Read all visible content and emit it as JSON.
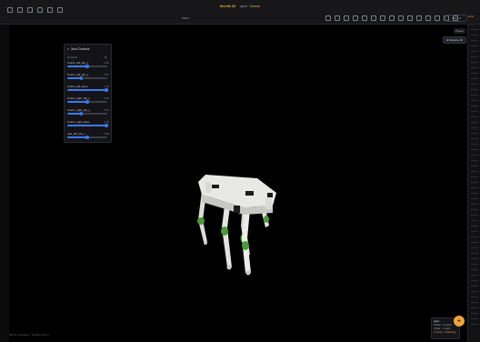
{
  "titlebar": {
    "app_title": "Kinetik 3D",
    "status_prefix": "quiet ·",
    "status_highlight": "branch",
    "file": "mass"
  },
  "toolbar": {
    "share_label": "Share ▾",
    "right_tab": "⊞ M"
  },
  "viewport": {
    "reset_label": "Preset",
    "reset_all_label": "⊕ Restore All",
    "footer_label": "Tap for overview · Scroll to zoom"
  },
  "joint_panel": {
    "title": "Joint Controls",
    "subtitle": "12 joints",
    "joints": [
      {
        "name": "FrontL_left_hip_x",
        "value": "0.00",
        "fraction": 0.5
      },
      {
        "name": "FrontL_left_hip_y",
        "value": "0.61",
        "fraction": 0.35
      },
      {
        "name": "FrontL_left_knee",
        "value": "0.00",
        "fraction": 0.98
      },
      {
        "name": "FrontL_right_hip_x",
        "value": "0.00",
        "fraction": 0.5
      },
      {
        "name": "FrontL_right_hip_y",
        "value": "0.61",
        "fraction": 0.35
      },
      {
        "name": "FrontL_right_knee",
        "value": "0.00",
        "fraction": 0.98
      },
      {
        "name": "rear_left_hip_x",
        "value": "0.00",
        "fraction": 0.5
      }
    ]
  },
  "info_box": {
    "title": "quad",
    "line1": "8 body · 12 joints",
    "line2": "8 links · 1 mesh",
    "line3": "⊘ errors · 0 warnings"
  },
  "colors": {
    "accent": "#f0a43c",
    "slider": "#3a7bf0",
    "joint_green": "#4c9a3a"
  }
}
